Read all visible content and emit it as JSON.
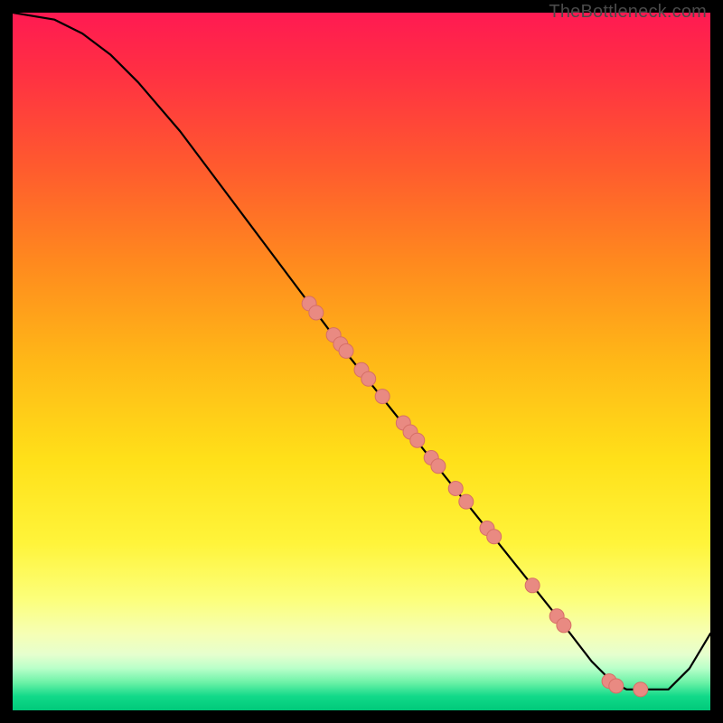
{
  "watermark": "TheBottleneck.com",
  "chart_data": {
    "type": "line",
    "title": "",
    "xlabel": "",
    "ylabel": "",
    "xlim": [
      0,
      100
    ],
    "ylim": [
      0,
      100
    ],
    "grid": false,
    "legend": false,
    "series": [
      {
        "name": "curve",
        "x": [
          0,
          6,
          10,
          14,
          18,
          24,
          30,
          36,
          42,
          48,
          54,
          60,
          66,
          72,
          78,
          83,
          86,
          88,
          90,
          94,
          97,
          100
        ],
        "y": [
          100,
          99,
          97,
          94,
          90,
          83,
          75,
          67,
          59,
          51,
          43.5,
          36,
          28.5,
          21,
          13.5,
          7,
          4,
          3,
          3,
          3,
          6,
          11
        ]
      }
    ],
    "points": {
      "name": "dots",
      "x": [
        42.5,
        43.5,
        46.0,
        47.0,
        47.8,
        50.0,
        51.0,
        53.0,
        56.0,
        57.0,
        58.0,
        60.0,
        61.0,
        63.5,
        65.0,
        68.0,
        69.0,
        74.5,
        78.0,
        79.0,
        85.5,
        86.5,
        90.0
      ],
      "y": [
        58.3,
        57.0,
        53.8,
        52.5,
        51.5,
        48.8,
        47.5,
        45.0,
        41.2,
        39.9,
        38.7,
        36.2,
        35.0,
        31.8,
        29.9,
        26.1,
        24.9,
        17.9,
        13.5,
        12.2,
        4.2,
        3.5,
        3.0
      ]
    },
    "colors": {
      "line": "#000000",
      "dot_fill": "#e98a82",
      "dot_stroke": "#d66f66"
    },
    "dot_radius_px": 8
  }
}
